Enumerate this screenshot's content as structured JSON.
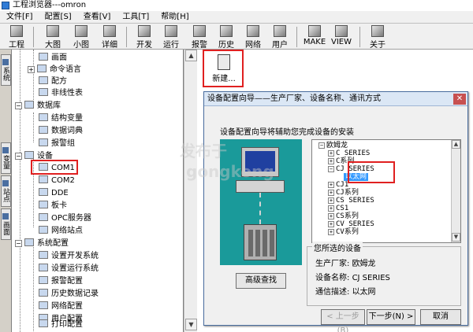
{
  "window": {
    "title": "工程浏览器---omron",
    "icon": "app-icon"
  },
  "menu": [
    "文件[F]",
    "配置[S]",
    "查看[V]",
    "工具[T]",
    "帮助[H]"
  ],
  "toolbar": [
    {
      "label": "工程",
      "icon": "project-icon"
    },
    {
      "label": "大图",
      "icon": "large-icons-icon"
    },
    {
      "label": "小图",
      "icon": "small-icons-icon"
    },
    {
      "label": "详细",
      "icon": "details-icon"
    },
    {
      "label": "开发",
      "icon": "develop-icon"
    },
    {
      "label": "运行",
      "icon": "run-icon"
    },
    {
      "label": "报警",
      "icon": "alarm-icon"
    },
    {
      "label": "历史",
      "icon": "history-icon"
    },
    {
      "label": "网络",
      "icon": "network-icon"
    },
    {
      "label": "用户",
      "icon": "user-icon"
    },
    {
      "label": "MAKE",
      "icon": "make-icon"
    },
    {
      "label": "VIEW",
      "icon": "view-icon"
    },
    {
      "label": "关于",
      "icon": "about-icon"
    }
  ],
  "left_tabs": [
    {
      "label": "系统",
      "icon": "system-tab-icon"
    },
    {
      "label": "变量",
      "icon": "variable-tab-icon"
    },
    {
      "label": "站点",
      "icon": "station-tab-icon"
    },
    {
      "label": "画面",
      "icon": "screen-tab-icon"
    }
  ],
  "tree": {
    "items": [
      {
        "label": "画面",
        "level": 2,
        "icon": "screen-icon"
      },
      {
        "label": "命令语言",
        "level": 2,
        "icon": "command-icon",
        "expander": "+"
      },
      {
        "label": "配方",
        "level": 2,
        "icon": "recipe-icon"
      },
      {
        "label": "非线性表",
        "level": 2,
        "icon": "table-icon"
      },
      {
        "label": "数据库",
        "level": 1,
        "icon": "database-icon",
        "expander": "−"
      },
      {
        "label": "结构变量",
        "level": 2,
        "icon": "struct-icon"
      },
      {
        "label": "数据词典",
        "level": 2,
        "icon": "dictionary-icon"
      },
      {
        "label": "报警组",
        "level": 2,
        "icon": "alarm-group-icon"
      },
      {
        "label": "设备",
        "level": 1,
        "icon": "device-icon",
        "expander": "−"
      },
      {
        "label": "COM1",
        "level": 2,
        "icon": "com-port-icon",
        "highlighted": true
      },
      {
        "label": "COM2",
        "level": 2,
        "icon": "com-port-icon"
      },
      {
        "label": "DDE",
        "level": 2,
        "icon": "dde-icon"
      },
      {
        "label": "板卡",
        "level": 2,
        "icon": "board-icon"
      },
      {
        "label": "OPC服务器",
        "level": 2,
        "icon": "opc-icon"
      },
      {
        "label": "网络站点",
        "level": 2,
        "icon": "network-station-icon"
      },
      {
        "label": "系统配置",
        "level": 1,
        "icon": "system-config-icon",
        "expander": "−"
      },
      {
        "label": "设置开发系统",
        "level": 2,
        "icon": "dev-setting-icon"
      },
      {
        "label": "设置运行系统",
        "level": 2,
        "icon": "run-setting-icon"
      },
      {
        "label": "报警配置",
        "level": 2,
        "icon": "alarm-config-icon"
      },
      {
        "label": "历史数据记录",
        "level": 2,
        "icon": "history-record-icon"
      },
      {
        "label": "网络配置",
        "level": 2,
        "icon": "network-config-icon"
      },
      {
        "label": "用户配置",
        "level": 2,
        "icon": "user-config-icon"
      },
      {
        "label": "打印配置",
        "level": 2,
        "icon": "print-config-icon"
      }
    ]
  },
  "workspace": {
    "new_item_label": "新建..."
  },
  "dialog": {
    "title": "设备配置向导——生产厂家、设备名称、通讯方式",
    "close_glyph": "✕",
    "subtitle": "设备配置向导将辅助您完成设备的安装",
    "advanced_button": "高级查找",
    "list": [
      {
        "label": "欧姆龙",
        "expander": "−",
        "level": 0
      },
      {
        "label": "C SERIES",
        "expander": "+",
        "level": 1
      },
      {
        "label": "C系列",
        "expander": "+",
        "level": 1
      },
      {
        "label": "CJ SERIES",
        "expander": "−",
        "level": 1
      },
      {
        "label": "以太网",
        "level": 2,
        "selected": true
      },
      {
        "label": "CJ1",
        "expander": "+",
        "level": 1
      },
      {
        "label": "CJ系列",
        "expander": "+",
        "level": 1
      },
      {
        "label": "CS SERIES",
        "expander": "+",
        "level": 1
      },
      {
        "label": "CS1",
        "expander": "+",
        "level": 1
      },
      {
        "label": "CS系列",
        "expander": "+",
        "level": 1
      },
      {
        "label": "CV SERIES",
        "expander": "+",
        "level": 1
      },
      {
        "label": "CV系列",
        "expander": "+",
        "level": 1
      }
    ],
    "selected_group": {
      "title": "您所选的设备",
      "vendor_label": "生产厂家:",
      "vendor": "欧姆龙",
      "device_label": "设备名称:",
      "device": "CJ SERIES",
      "comm_label": "通信描述:",
      "comm": "以太网"
    },
    "buttons": {
      "prev": "< 上一步(B)",
      "next": "下一步(N) >",
      "cancel": "取消"
    }
  },
  "watermark": [
    "发布于",
    "gongkong"
  ],
  "colors": {
    "highlight_border": "#e02020",
    "selection": "#3399ff",
    "illustration": "#1a9a9a"
  }
}
